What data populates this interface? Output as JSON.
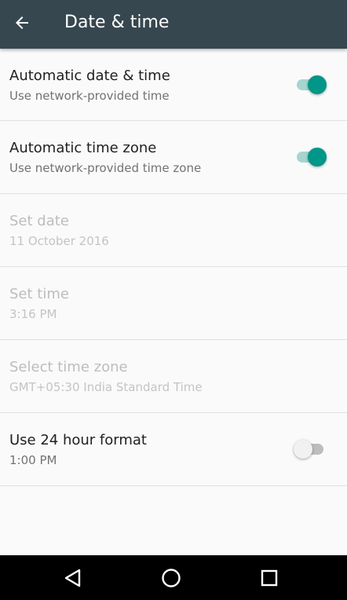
{
  "header": {
    "title": "Date & time",
    "back_icon": "arrow-back-icon"
  },
  "colors": {
    "app_bar": "#37474f",
    "accent": "#009688",
    "background": "#fafafa",
    "nav_bar": "#000000"
  },
  "settings": [
    {
      "title": "Automatic date & time",
      "subtitle": "Use network-provided time",
      "enabled": true,
      "has_switch": true,
      "switch_on": true
    },
    {
      "title": "Automatic time zone",
      "subtitle": "Use network-provided time zone",
      "enabled": true,
      "has_switch": true,
      "switch_on": true
    },
    {
      "title": "Set date",
      "subtitle": "11 October 2016",
      "enabled": false,
      "has_switch": false
    },
    {
      "title": "Set time",
      "subtitle": "3:16 PM",
      "enabled": false,
      "has_switch": false
    },
    {
      "title": "Select time zone",
      "subtitle": "GMT+05:30 India Standard Time",
      "enabled": false,
      "has_switch": false
    },
    {
      "title": "Use 24 hour format",
      "subtitle": "1:00 PM",
      "enabled": true,
      "has_switch": true,
      "switch_on": false
    }
  ],
  "navbar": {
    "back_icon": "nav-back-icon",
    "home_icon": "nav-home-icon",
    "recents_icon": "nav-recents-icon"
  }
}
